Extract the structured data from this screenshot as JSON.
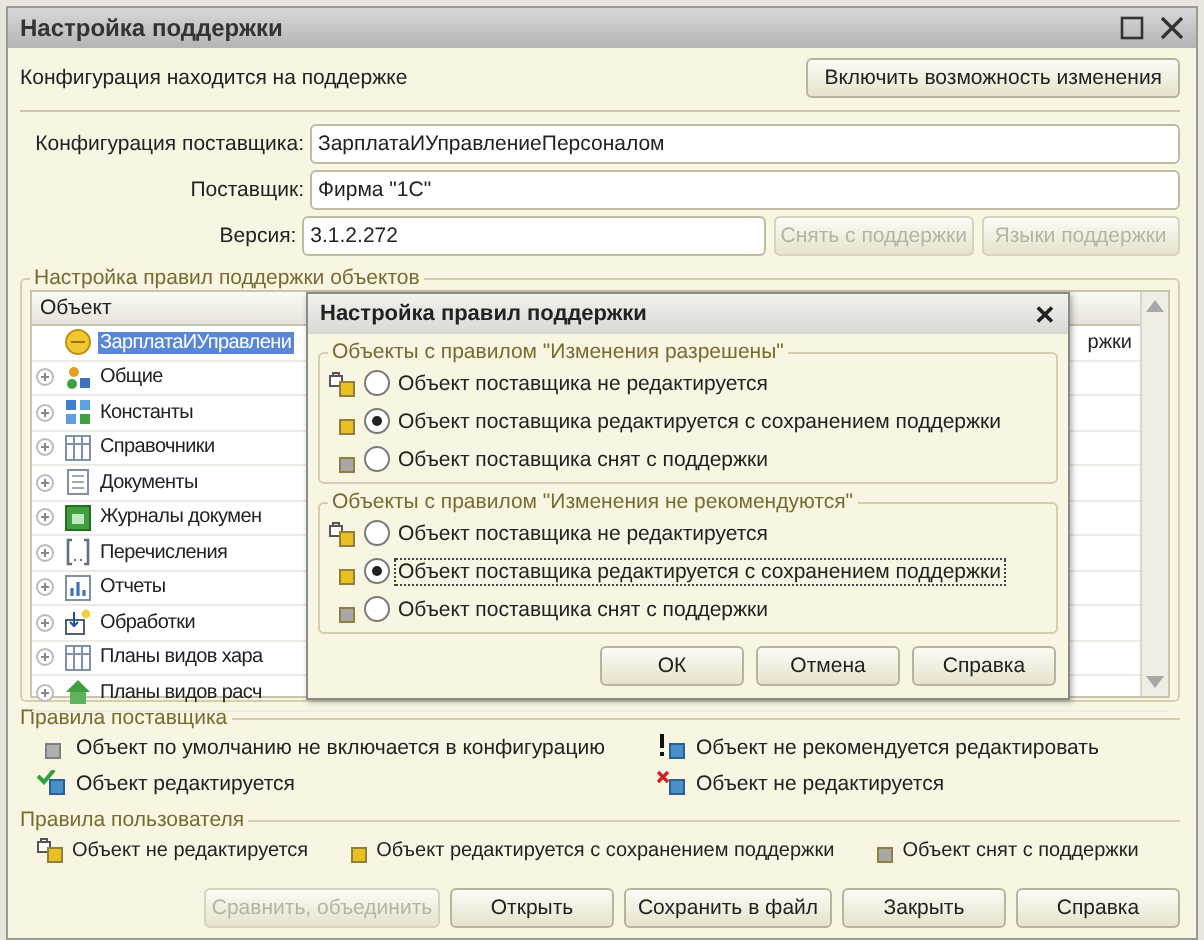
{
  "window": {
    "title": "Настройка поддержки"
  },
  "status": {
    "text": "Конфигурация находится на поддержке",
    "button": "Включить возможность изменения"
  },
  "fields": [
    {
      "label": "Конфигурация поставщика:",
      "value": "ЗарплатаИУправлениеПерсоналом"
    },
    {
      "label": "Поставщик:",
      "value": "Фирма \"1С\""
    },
    {
      "label": "Версия:",
      "value": "3.1.2.272"
    }
  ],
  "version_buttons": [
    {
      "label": "Снять с поддержки",
      "disabled": true
    },
    {
      "label": "Языки поддержки",
      "disabled": true
    }
  ],
  "objects": {
    "title": "Настройка правил поддержки объектов",
    "columns": [
      "Объект"
    ],
    "rows": [
      {
        "name": "ЗарплатаИУправлени",
        "kind": "root",
        "selected": true,
        "column_2": "ржки"
      },
      {
        "name": "Общие",
        "kind": "common",
        "selected": false
      },
      {
        "name": "Константы",
        "kind": "constants",
        "selected": false
      },
      {
        "name": "Справочники",
        "kind": "catalogs",
        "selected": false
      },
      {
        "name": "Документы",
        "kind": "documents",
        "selected": false
      },
      {
        "name": "Журналы докумен",
        "kind": "journals",
        "selected": false
      },
      {
        "name": "Перечисления",
        "kind": "enums",
        "selected": false
      },
      {
        "name": "Отчеты",
        "kind": "reports",
        "selected": false
      },
      {
        "name": "Обработки",
        "kind": "processing",
        "selected": false
      },
      {
        "name": "Планы видов хара",
        "kind": "plans",
        "selected": false
      },
      {
        "name": "Планы видов расч",
        "kind": "calc",
        "selected": false
      }
    ]
  },
  "supplier_rules": {
    "title": "Правила поставщика",
    "items": [
      {
        "label": "Объект по умолчанию не включается в конфигурацию",
        "kind": "excluded"
      },
      {
        "label": "Объект не рекомендуется редактировать",
        "kind": "warning"
      },
      {
        "label": "Объект редактируется",
        "kind": "editable"
      },
      {
        "label": "Объект не редактируется",
        "kind": "locked"
      }
    ]
  },
  "user_rules": {
    "title": "Правила пользователя",
    "items": [
      {
        "label": "Объект не редактируется",
        "kind": "locked"
      },
      {
        "label": "Объект редактируется с сохранением поддержки",
        "kind": "kept"
      },
      {
        "label": "Объект снят с поддержки",
        "kind": "removed"
      }
    ]
  },
  "buttons": [
    {
      "label": "Сравнить, объединить",
      "disabled": true
    },
    {
      "label": "Открыть",
      "disabled": false
    },
    {
      "label": "Сохранить в файл",
      "disabled": false
    },
    {
      "label": "Закрыть",
      "disabled": false
    },
    {
      "label": "Справка",
      "disabled": false
    }
  ],
  "dialog": {
    "title": "Настройка правил поддержки",
    "close": "✕",
    "groups": [
      {
        "title": "Объекты с правилом \"Изменения разрешены\"",
        "options": [
          {
            "label": "Объект поставщика не редактируется",
            "kind": "locked",
            "selected": false,
            "focused": false
          },
          {
            "label": "Объект поставщика редактируется с сохранением поддержки",
            "kind": "kept",
            "selected": true,
            "focused": false
          },
          {
            "label": "Объект поставщика снят с поддержки",
            "kind": "removed",
            "selected": false,
            "focused": false
          }
        ]
      },
      {
        "title": "Объекты с правилом \"Изменения не рекомендуются\"",
        "options": [
          {
            "label": "Объект поставщика не редактируется",
            "kind": "locked",
            "selected": false,
            "focused": false
          },
          {
            "label": "Объект поставщика редактируется с сохранением поддержки",
            "kind": "kept",
            "selected": true,
            "focused": true
          },
          {
            "label": "Объект поставщика снят с поддержки",
            "kind": "removed",
            "selected": false,
            "focused": false
          }
        ]
      }
    ],
    "buttons": [
      "ОК",
      "Отмена",
      "Справка"
    ]
  }
}
